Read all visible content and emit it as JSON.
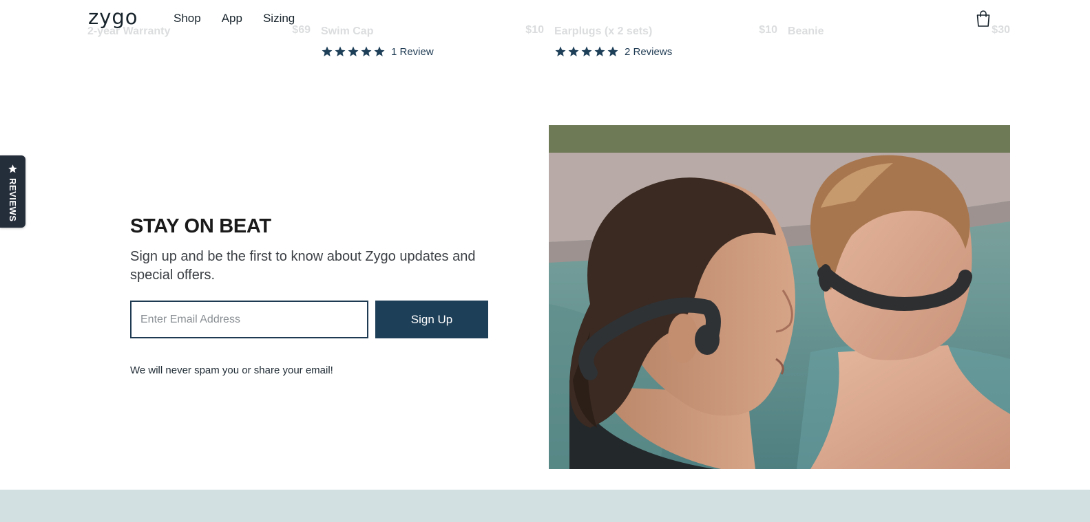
{
  "header": {
    "logo": "zygo",
    "nav": [
      "Shop",
      "App",
      "Sizing"
    ],
    "cart_icon": "shopping-bag-icon"
  },
  "products": [
    {
      "name": "2-year Warranty",
      "price": "$69"
    },
    {
      "name": "Swim Cap",
      "price": "$10",
      "rating": 5,
      "review_text": "1 Review"
    },
    {
      "name": "Earplugs (x 2 sets)",
      "price": "$10",
      "rating": 5,
      "review_text": "2 Reviews"
    },
    {
      "name": "Beanie",
      "price": "$30"
    }
  ],
  "reviews_tab": {
    "label": "REVIEWS",
    "icon": "star-icon"
  },
  "newsletter": {
    "title": "STAY ON BEAT",
    "subtitle": "Sign up and be the first to know about Zygo updates and special offers.",
    "email_placeholder": "Enter Email Address",
    "button_label": "Sign Up",
    "note": "We will never spam you or share your email!"
  },
  "colors": {
    "navy": "#1e3f58",
    "reviews_tab": "#242d3a",
    "band": "#d3e0e1",
    "text": "#17232b"
  }
}
